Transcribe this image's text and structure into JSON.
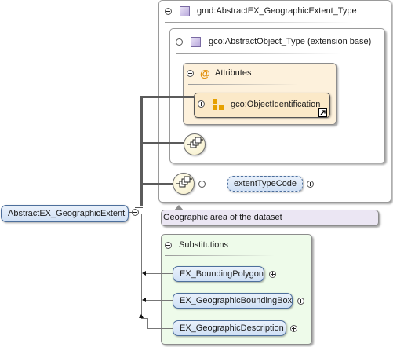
{
  "complex_type": {
    "label": "gmd:AbstractEX_GeographicExtent_Type"
  },
  "extension_base": {
    "label": "gco:AbstractObject_Type (extension base)"
  },
  "attributes": {
    "label": "Attributes",
    "icon": "at-sign-icon"
  },
  "attribute_group": {
    "label": "gco:ObjectIdentification"
  },
  "root_element": {
    "label": "AbstractEX_GeographicExtent"
  },
  "child_element": {
    "label": "extentTypeCode"
  },
  "annotation": {
    "text": "Geographic area of the dataset"
  },
  "substitutions": {
    "label": "Substitutions",
    "items": [
      {
        "label": "EX_BoundingPolygon"
      },
      {
        "label": "EX_GeographicBoundingBox"
      },
      {
        "label": "EX_GeographicDescription"
      }
    ]
  },
  "colors": {
    "type_box_bg": "#ffffff",
    "attributes_bg": "#fdf1dc",
    "attribute_group_bg": "#fbe9c8",
    "substitutions_bg": "#eefbea",
    "annotation_bg": "#ebe6f3",
    "element_fill": "#d9e6f7",
    "element_border": "#4d6f9c"
  }
}
